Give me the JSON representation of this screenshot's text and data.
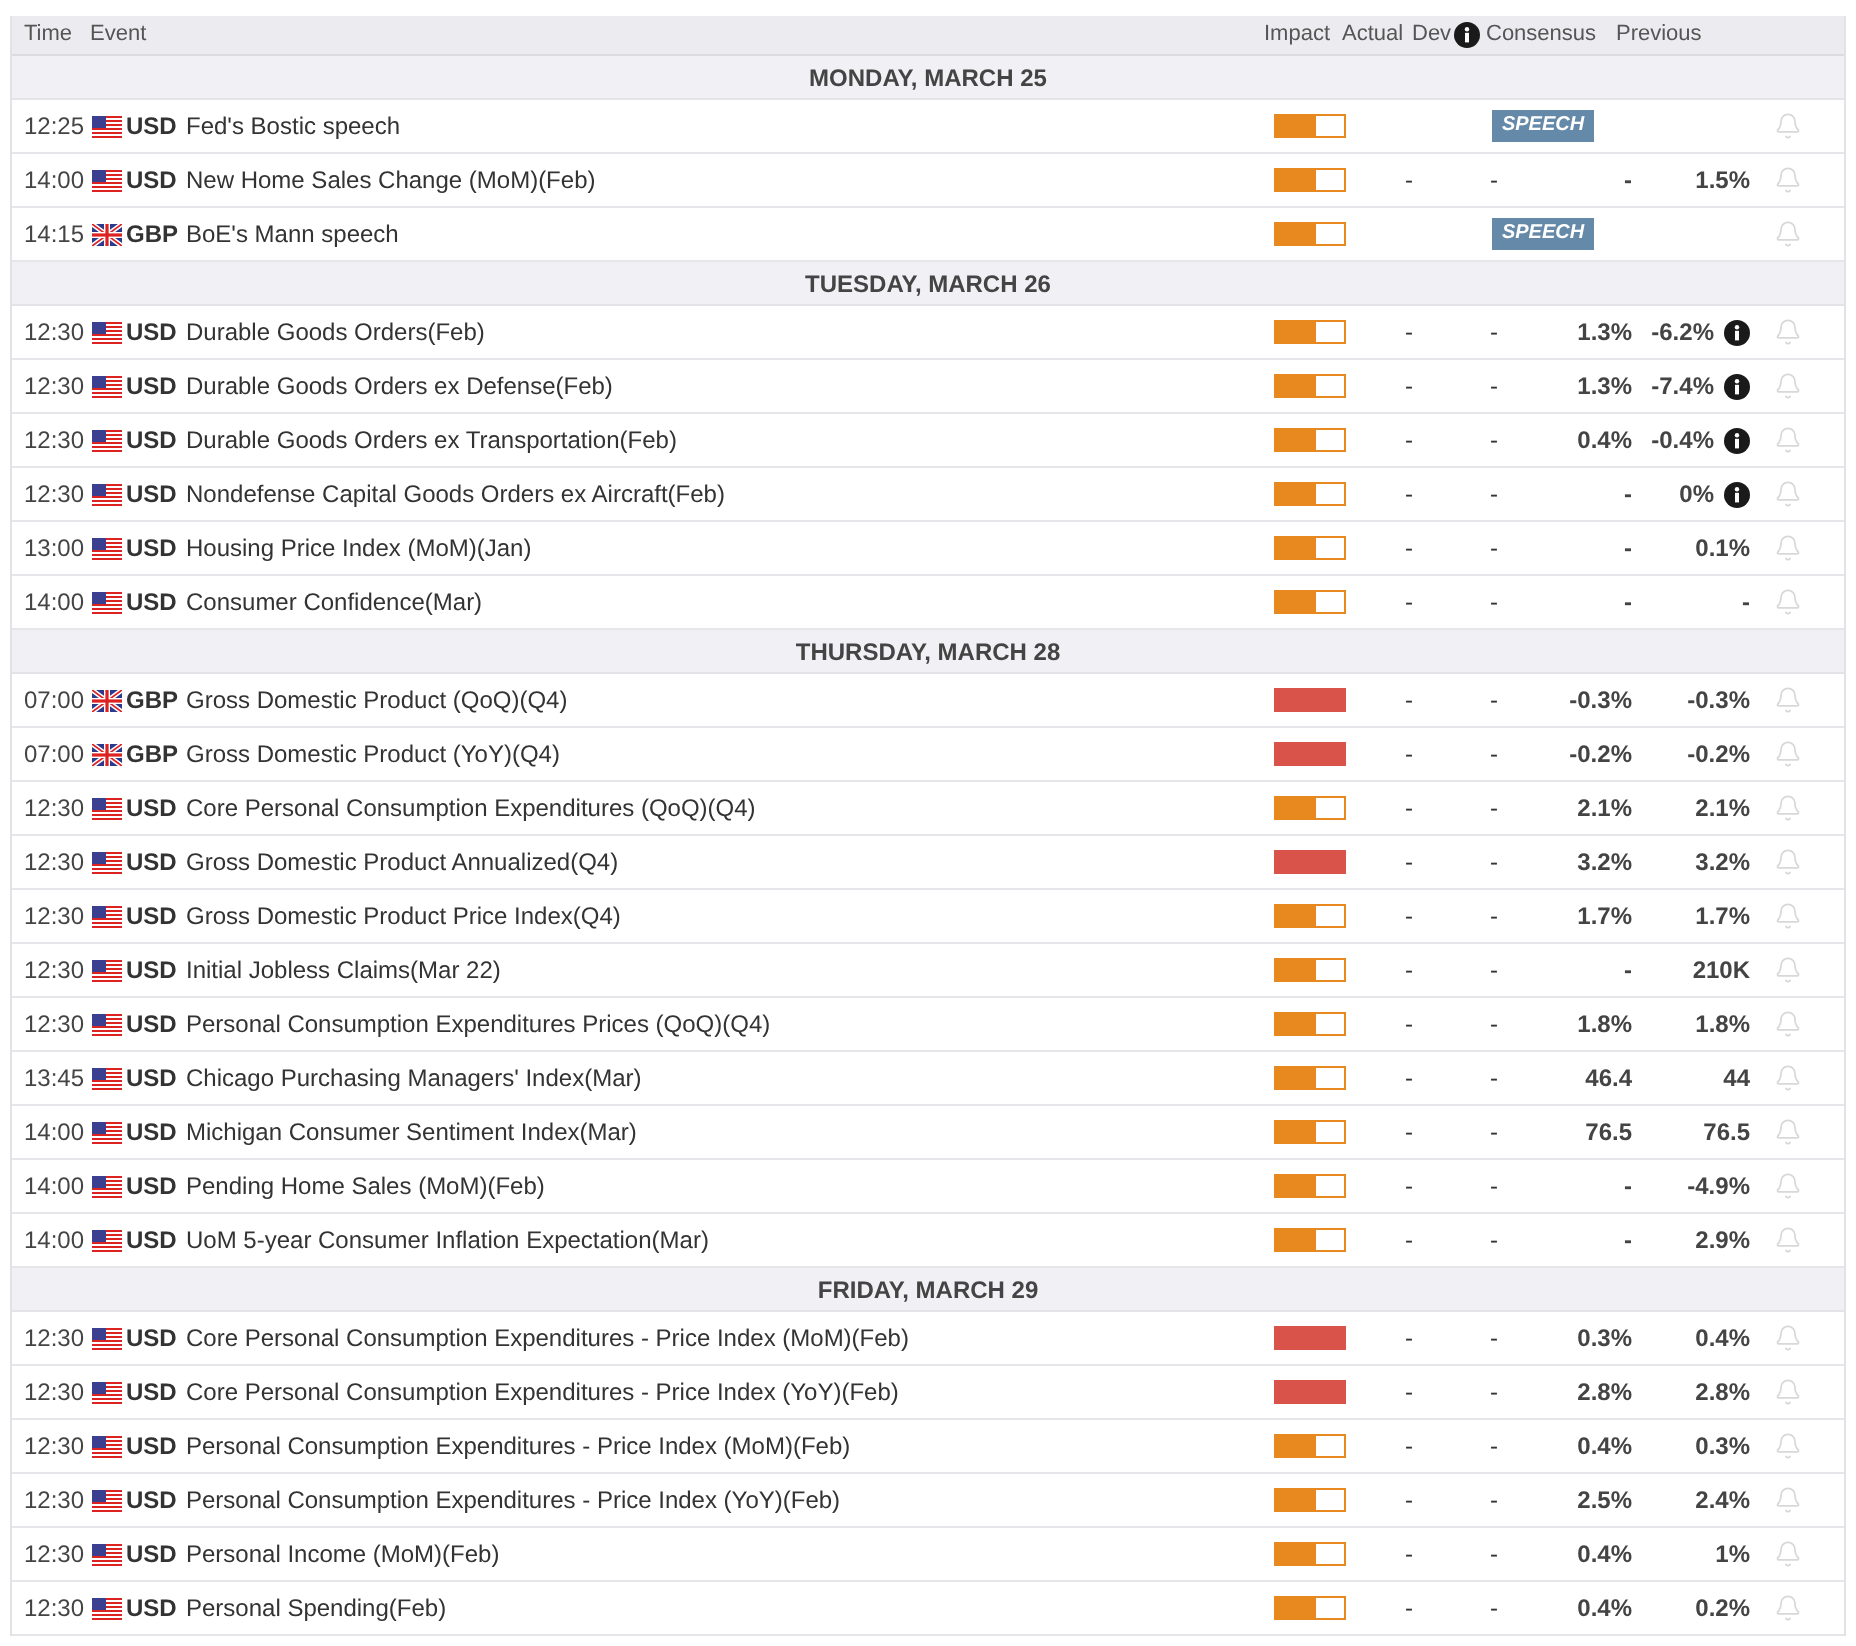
{
  "header": {
    "time": "Time",
    "event": "Event",
    "impact": "Impact",
    "actual": "Actual",
    "dev": "Dev",
    "consensus": "Consensus",
    "previous": "Previous"
  },
  "days": [
    {
      "title": "MONDAY, MARCH 25",
      "events": [
        {
          "time": "12:25",
          "kind": "us",
          "currency": "USD",
          "event": "Fed's Bostic speech",
          "level": 0.6,
          "tag": "SPEECH"
        },
        {
          "time": "14:00",
          "kind": "us",
          "currency": "USD",
          "event": "New Home Sales Change (MoM)(Feb)",
          "level": 0.6,
          "actual": "-",
          "dev": "-",
          "consensus": "-",
          "previous": "1.5%",
          "info": false
        },
        {
          "time": "14:15",
          "kind": "gb",
          "currency": "GBP",
          "event": "BoE's Mann speech",
          "level": 0.6,
          "tag": "SPEECH"
        }
      ]
    },
    {
      "title": "TUESDAY, MARCH 26",
      "events": [
        {
          "time": "12:30",
          "kind": "us",
          "currency": "USD",
          "event": "Durable Goods Orders(Feb)",
          "level": 0.6,
          "actual": "-",
          "dev": "-",
          "consensus": "1.3%",
          "previous": "-6.2%",
          "info": true
        },
        {
          "time": "12:30",
          "kind": "us",
          "currency": "USD",
          "event": "Durable Goods Orders ex Defense(Feb)",
          "level": 0.6,
          "actual": "-",
          "dev": "-",
          "consensus": "1.3%",
          "previous": "-7.4%",
          "info": true
        },
        {
          "time": "12:30",
          "kind": "us",
          "currency": "USD",
          "event": "Durable Goods Orders ex Transportation(Feb)",
          "level": 0.6,
          "actual": "-",
          "dev": "-",
          "consensus": "0.4%",
          "previous": "-0.4%",
          "info": true
        },
        {
          "time": "12:30",
          "kind": "us",
          "currency": "USD",
          "event": "Nondefense Capital Goods Orders ex Aircraft(Feb)",
          "level": 0.6,
          "actual": "-",
          "dev": "-",
          "consensus": "-",
          "previous": "0%",
          "info": true
        },
        {
          "time": "13:00",
          "kind": "us",
          "currency": "USD",
          "event": "Housing Price Index (MoM)(Jan)",
          "level": 0.6,
          "actual": "-",
          "dev": "-",
          "consensus": "-",
          "previous": "0.1%",
          "info": false
        },
        {
          "time": "14:00",
          "kind": "us",
          "currency": "USD",
          "event": "Consumer Confidence(Mar)",
          "level": 0.6,
          "actual": "-",
          "dev": "-",
          "consensus": "-",
          "previous": "-",
          "info": false
        }
      ]
    },
    {
      "title": "THURSDAY, MARCH 28",
      "events": [
        {
          "time": "07:00",
          "kind": "gb",
          "currency": "GBP",
          "event": "Gross Domestic Product (QoQ)(Q4)",
          "level": 1,
          "actual": "-",
          "dev": "-",
          "consensus": "-0.3%",
          "previous": "-0.3%",
          "info": false
        },
        {
          "time": "07:00",
          "kind": "gb",
          "currency": "GBP",
          "event": "Gross Domestic Product (YoY)(Q4)",
          "level": 1,
          "actual": "-",
          "dev": "-",
          "consensus": "-0.2%",
          "previous": "-0.2%",
          "info": false
        },
        {
          "time": "12:30",
          "kind": "us",
          "currency": "USD",
          "event": "Core Personal Consumption Expenditures (QoQ)(Q4)",
          "level": 0.6,
          "actual": "-",
          "dev": "-",
          "consensus": "2.1%",
          "previous": "2.1%",
          "info": false
        },
        {
          "time": "12:30",
          "kind": "us",
          "currency": "USD",
          "event": "Gross Domestic Product Annualized(Q4)",
          "level": 1,
          "actual": "-",
          "dev": "-",
          "consensus": "3.2%",
          "previous": "3.2%",
          "info": false
        },
        {
          "time": "12:30",
          "kind": "us",
          "currency": "USD",
          "event": "Gross Domestic Product Price Index(Q4)",
          "level": 0.6,
          "actual": "-",
          "dev": "-",
          "consensus": "1.7%",
          "previous": "1.7%",
          "info": false
        },
        {
          "time": "12:30",
          "kind": "us",
          "currency": "USD",
          "event": "Initial Jobless Claims(Mar 22)",
          "level": 0.6,
          "actual": "-",
          "dev": "-",
          "consensus": "-",
          "previous": "210K",
          "info": false
        },
        {
          "time": "12:30",
          "kind": "us",
          "currency": "USD",
          "event": "Personal Consumption Expenditures Prices (QoQ)(Q4)",
          "level": 0.6,
          "actual": "-",
          "dev": "-",
          "consensus": "1.8%",
          "previous": "1.8%",
          "info": false
        },
        {
          "time": "13:45",
          "kind": "us",
          "currency": "USD",
          "event": "Chicago Purchasing Managers' Index(Mar)",
          "level": 0.6,
          "actual": "-",
          "dev": "-",
          "consensus": "46.4",
          "previous": "44",
          "info": false
        },
        {
          "time": "14:00",
          "kind": "us",
          "currency": "USD",
          "event": "Michigan Consumer Sentiment Index(Mar)",
          "level": 0.6,
          "actual": "-",
          "dev": "-",
          "consensus": "76.5",
          "previous": "76.5",
          "info": false
        },
        {
          "time": "14:00",
          "kind": "us",
          "currency": "USD",
          "event": "Pending Home Sales (MoM)(Feb)",
          "level": 0.6,
          "actual": "-",
          "dev": "-",
          "consensus": "-",
          "previous": "-4.9%",
          "info": false
        },
        {
          "time": "14:00",
          "kind": "us",
          "currency": "USD",
          "event": "UoM 5-year Consumer Inflation Expectation(Mar)",
          "level": 0.6,
          "actual": "-",
          "dev": "-",
          "consensus": "-",
          "previous": "2.9%",
          "info": false
        }
      ]
    },
    {
      "title": "FRIDAY, MARCH 29",
      "events": [
        {
          "time": "12:30",
          "kind": "us",
          "currency": "USD",
          "event": "Core Personal Consumption Expenditures - Price Index (MoM)(Feb)",
          "level": 1,
          "actual": "-",
          "dev": "-",
          "consensus": "0.3%",
          "previous": "0.4%",
          "info": false
        },
        {
          "time": "12:30",
          "kind": "us",
          "currency": "USD",
          "event": "Core Personal Consumption Expenditures - Price Index (YoY)(Feb)",
          "level": 1,
          "actual": "-",
          "dev": "-",
          "consensus": "2.8%",
          "previous": "2.8%",
          "info": false
        },
        {
          "time": "12:30",
          "kind": "us",
          "currency": "USD",
          "event": "Personal Consumption Expenditures - Price Index (MoM)(Feb)",
          "level": 0.6,
          "actual": "-",
          "dev": "-",
          "consensus": "0.4%",
          "previous": "0.3%",
          "info": false
        },
        {
          "time": "12:30",
          "kind": "us",
          "currency": "USD",
          "event": "Personal Consumption Expenditures - Price Index (YoY)(Feb)",
          "level": 0.6,
          "actual": "-",
          "dev": "-",
          "consensus": "2.5%",
          "previous": "2.4%",
          "info": false
        },
        {
          "time": "12:30",
          "kind": "us",
          "currency": "USD",
          "event": "Personal Income (MoM)(Feb)",
          "level": 0.6,
          "actual": "-",
          "dev": "-",
          "consensus": "0.4%",
          "previous": "1%",
          "info": false
        },
        {
          "time": "12:30",
          "kind": "us",
          "currency": "USD",
          "event": "Personal Spending(Feb)",
          "level": 0.6,
          "actual": "-",
          "dev": "-",
          "consensus": "0.4%",
          "previous": "0.2%",
          "info": false
        }
      ]
    }
  ]
}
